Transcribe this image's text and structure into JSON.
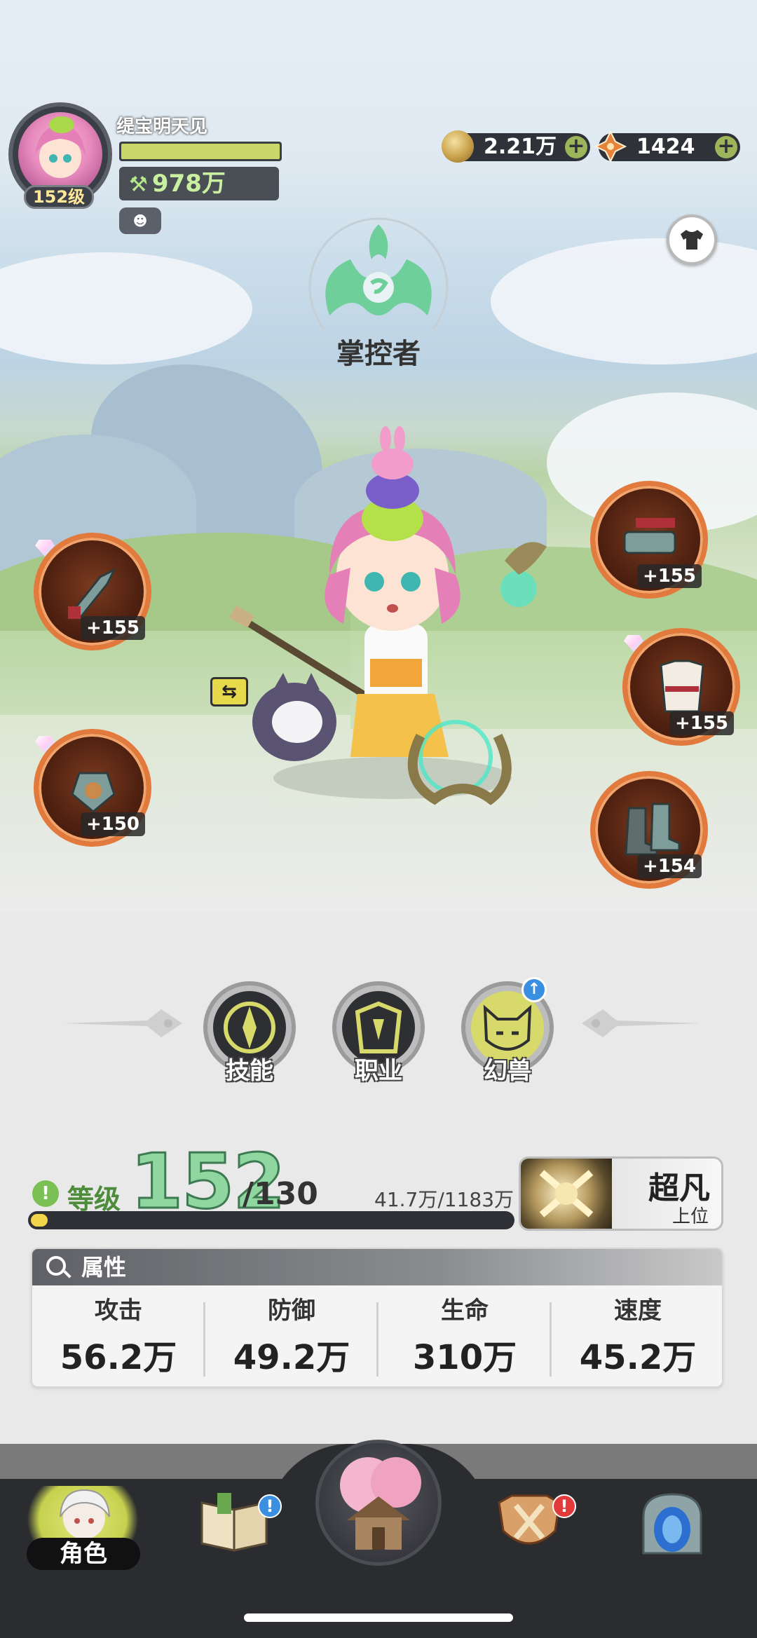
{
  "player": {
    "name": "缇宝明天见",
    "level_badge": "152级",
    "power": "978万",
    "xp_fill": 1.0
  },
  "currency": [
    {
      "icon": "gold-coin-icon",
      "amount": "2.21万"
    },
    {
      "icon": "orange-gem-icon",
      "amount": "1424"
    }
  ],
  "class_name": "掌控者",
  "equipment": {
    "weapon": "+155",
    "offhand": "+150",
    "belt": "+155",
    "armor": "+155",
    "boots": "+154"
  },
  "skills": [
    {
      "label": "技能"
    },
    {
      "label": "职业"
    },
    {
      "label": "幻兽"
    }
  ],
  "level": {
    "label": "等级",
    "value": "152",
    "cap": "/130",
    "exp": "41.7万/1183万",
    "exp_fraction": 0.035
  },
  "rank": {
    "title": "超凡",
    "sub": "上位"
  },
  "attributes": {
    "title": "属性",
    "items": [
      {
        "key": "攻击",
        "value": "56.2万"
      },
      {
        "key": "防御",
        "value": "49.2万"
      },
      {
        "key": "生命",
        "value": "310万"
      },
      {
        "key": "速度",
        "value": "45.2万"
      }
    ]
  },
  "nav": {
    "role_label": "角色",
    "alert_mark": "!",
    "up_mark": "↑",
    "plus_mark": "+",
    "swap_mark": "⇆",
    "power_mark": "⚒",
    "pet_mark": "☻"
  },
  "colors": {
    "slot_border": "#e27a3d",
    "level_green": "#8fd6a0",
    "alert_red": "#e23a3a",
    "alert_blue": "#3a8fe0"
  }
}
